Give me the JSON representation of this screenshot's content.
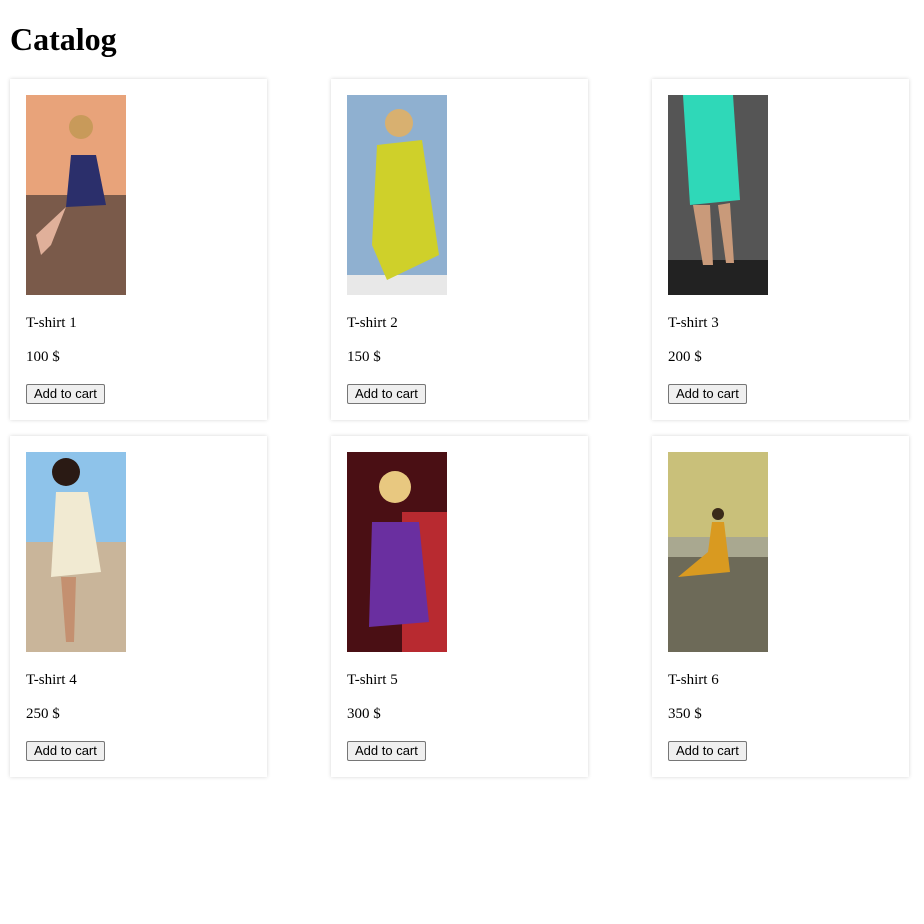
{
  "page": {
    "title": "Catalog"
  },
  "products": [
    {
      "name": "T-shirt 1",
      "price": "100 $",
      "button": "Add to cart",
      "image_icon": "dress-photo-navy-sunset",
      "colors": {
        "sky": "#e8a37a",
        "dress": "#2b2f6b",
        "ground": "#7a5a4a"
      }
    },
    {
      "name": "T-shirt 2",
      "price": "150 $",
      "button": "Add to cart",
      "image_icon": "dress-photo-yellow",
      "colors": {
        "sky": "#8fb0d0",
        "dress": "#cfd02a",
        "ground": "#e8e8e8"
      }
    },
    {
      "name": "T-shirt 3",
      "price": "200 $",
      "button": "Add to cart",
      "image_icon": "dress-photo-turquoise",
      "colors": {
        "sky": "#555555",
        "dress": "#2fd8b8",
        "ground": "#222222"
      }
    },
    {
      "name": "T-shirt 4",
      "price": "250 $",
      "button": "Add to cart",
      "image_icon": "dress-photo-cream-beach",
      "colors": {
        "sky": "#8ec3ea",
        "dress": "#f1ead2",
        "ground": "#c9b59a"
      }
    },
    {
      "name": "T-shirt 5",
      "price": "300 $",
      "button": "Add to cart",
      "image_icon": "dress-photo-purple",
      "colors": {
        "sky": "#4a0f14",
        "dress": "#6a2fa0",
        "ground": "#b82a30"
      }
    },
    {
      "name": "T-shirt 6",
      "price": "350 $",
      "button": "Add to cart",
      "image_icon": "dress-photo-orange-sea",
      "colors": {
        "sky": "#c9c07a",
        "dress": "#d99a20",
        "ground": "#6d6a58"
      }
    }
  ]
}
